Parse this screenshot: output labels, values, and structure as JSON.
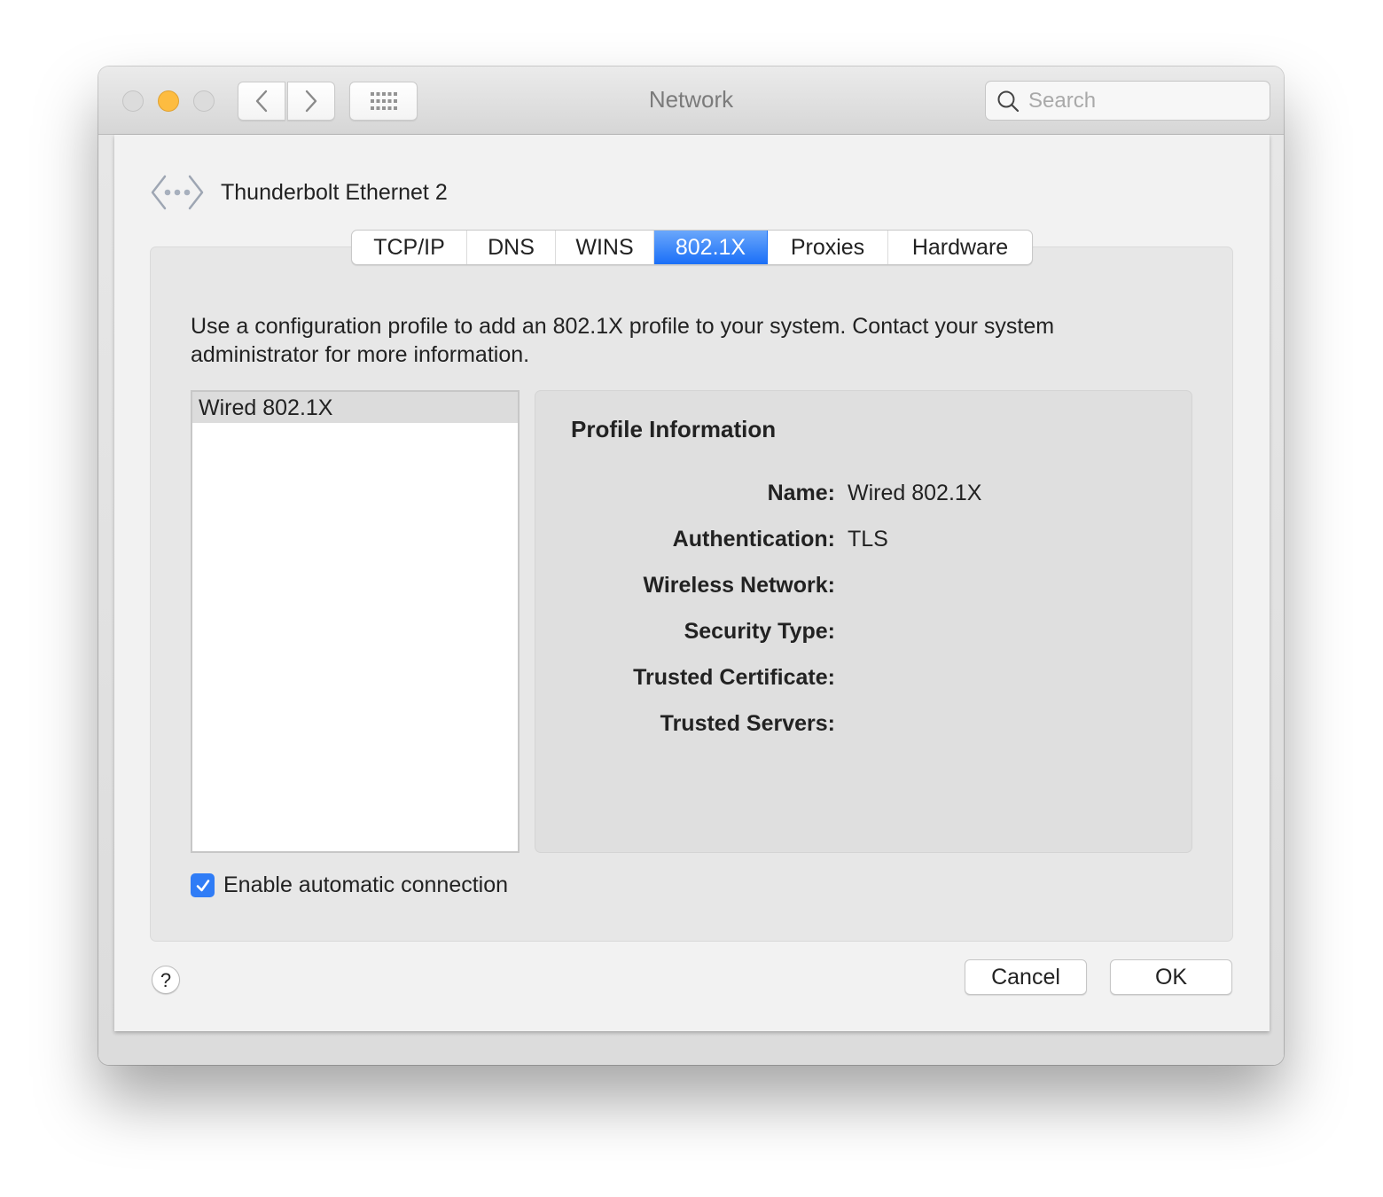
{
  "window": {
    "title": "Network",
    "search_placeholder": "Search",
    "icons": {
      "back": "chevron-left-icon",
      "forward": "chevron-right-icon",
      "show_all": "grid-icon",
      "search": "magnifier-icon"
    }
  },
  "interface": {
    "name": "Thunderbolt Ethernet 2",
    "icon": "ethernet-icon"
  },
  "tabs": [
    {
      "label": "TCP/IP",
      "active": false
    },
    {
      "label": "DNS",
      "active": false
    },
    {
      "label": "WINS",
      "active": false
    },
    {
      "label": "802.1X",
      "active": true
    },
    {
      "label": "Proxies",
      "active": false
    },
    {
      "label": "Hardware",
      "active": false
    }
  ],
  "content": {
    "description": "Use a configuration profile to add an 802.1X profile to your system. Contact your system administrator for more information.",
    "profiles": [
      {
        "name": "Wired 802.1X",
        "selected": true
      }
    ],
    "profile_info": {
      "title": "Profile Information",
      "rows": [
        {
          "label": "Name:",
          "value": "Wired 802.1X"
        },
        {
          "label": "Authentication:",
          "value": "TLS"
        },
        {
          "label": "Wireless Network:",
          "value": ""
        },
        {
          "label": "Security Type:",
          "value": ""
        },
        {
          "label": "Trusted Certificate:",
          "value": ""
        },
        {
          "label": "Trusted Servers:",
          "value": ""
        }
      ]
    },
    "auto_connect": {
      "label": "Enable automatic connection",
      "checked": true
    }
  },
  "footer": {
    "help_label": "?",
    "cancel_label": "Cancel",
    "ok_label": "OK"
  },
  "colors": {
    "accent": "#1a6ff7",
    "minimize": "#fdbc40"
  }
}
